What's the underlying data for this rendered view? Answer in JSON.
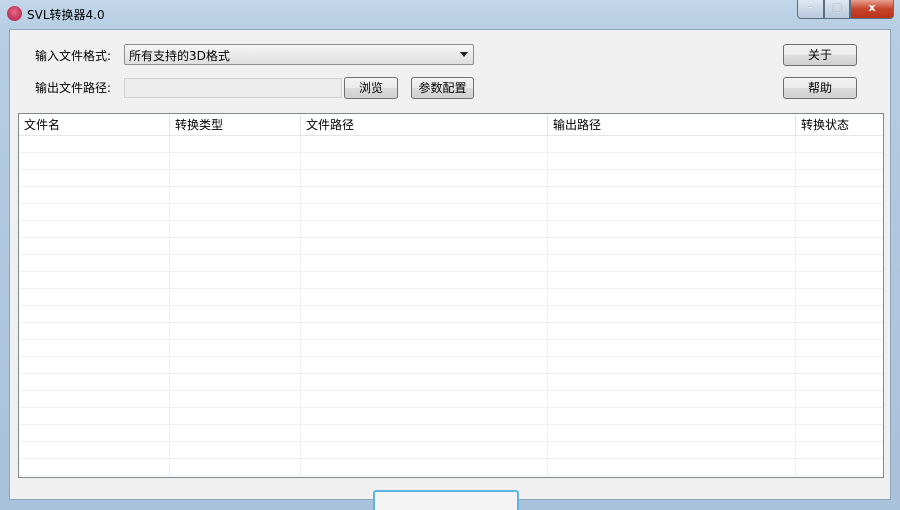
{
  "window": {
    "title": "SVL转换器4.0",
    "minimize": "–",
    "maximize": "□",
    "close": "x"
  },
  "form": {
    "input_format_label": "输入文件格式:",
    "input_format_value": "所有支持的3D格式",
    "output_path_label": "输出文件路径:",
    "output_path_value": "",
    "browse_label": "浏览",
    "config_label": "参数配置",
    "about_label": "关于",
    "help_label": "帮助"
  },
  "table": {
    "columns": [
      "文件名",
      "转换类型",
      "文件路径",
      "输出路径",
      "转换状态"
    ],
    "rows": []
  }
}
